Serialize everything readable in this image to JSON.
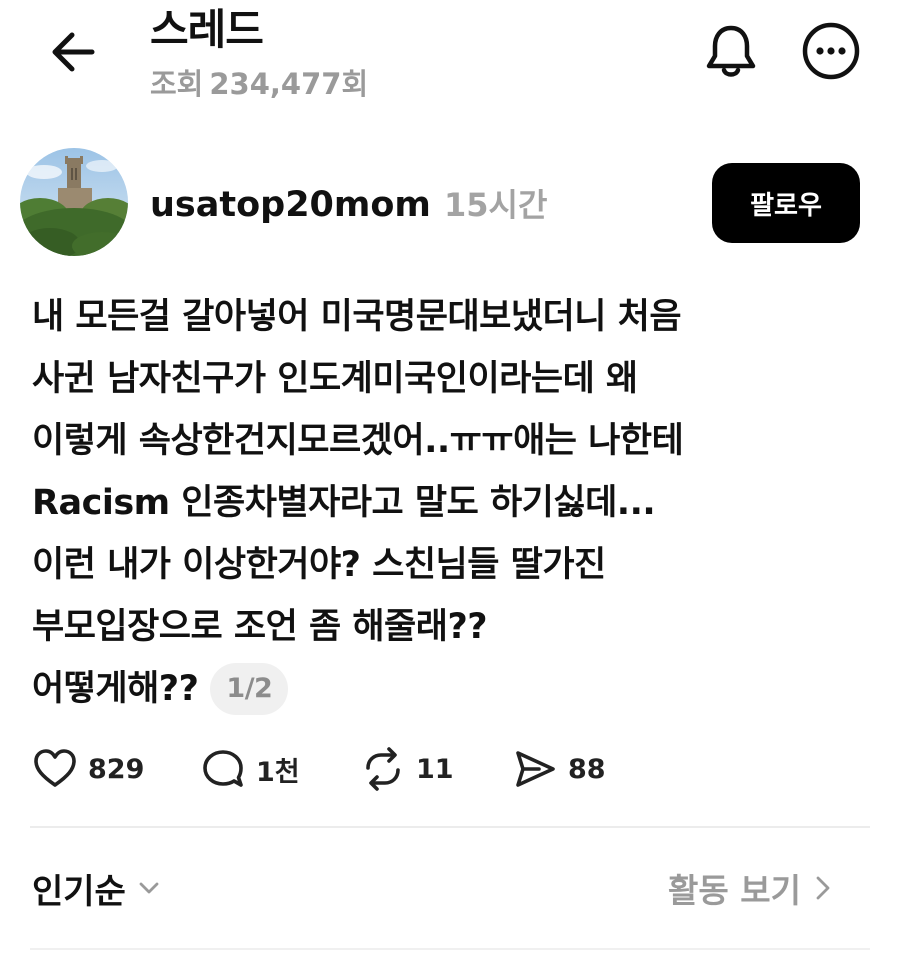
{
  "header": {
    "title": "스레드",
    "views_label": "조회",
    "views_count": "234,477회",
    "icons": {
      "back": "arrow-left-icon",
      "bell": "bell-icon",
      "more": "more-icon"
    }
  },
  "author": {
    "username": "usatop20mom",
    "time": "15시간",
    "follow_label": "팔로우",
    "avatar": "avatar-image"
  },
  "post": {
    "lines": [
      "내 모든걸 갈아넣어 미국명문대보냈더니 처음",
      "사귄 남자친구가 인도계미국인이라는데 왜",
      "이렇게 속상한건지모르겠어..ㅠㅠ애는 나한테",
      "Racism 인종차별자라고 말도 하기싫데...",
      "이런 내가 이상한거야? 스친님들 딸가진",
      "부모입장으로 조언 좀 해줄래??",
      "어떻게해??"
    ],
    "page_indicator": "1/2"
  },
  "actions": {
    "likes": "829",
    "replies": "1천",
    "reposts": "11",
    "shares": "88"
  },
  "sort": {
    "label": "인기순",
    "activity_label": "활동 보기"
  },
  "colors": {
    "text": "#111111",
    "muted": "#9a9a9a",
    "follow_bg": "#000000",
    "follow_text": "#ffffff",
    "pill_bg": "#f0f0f0",
    "divider": "#ececec"
  }
}
